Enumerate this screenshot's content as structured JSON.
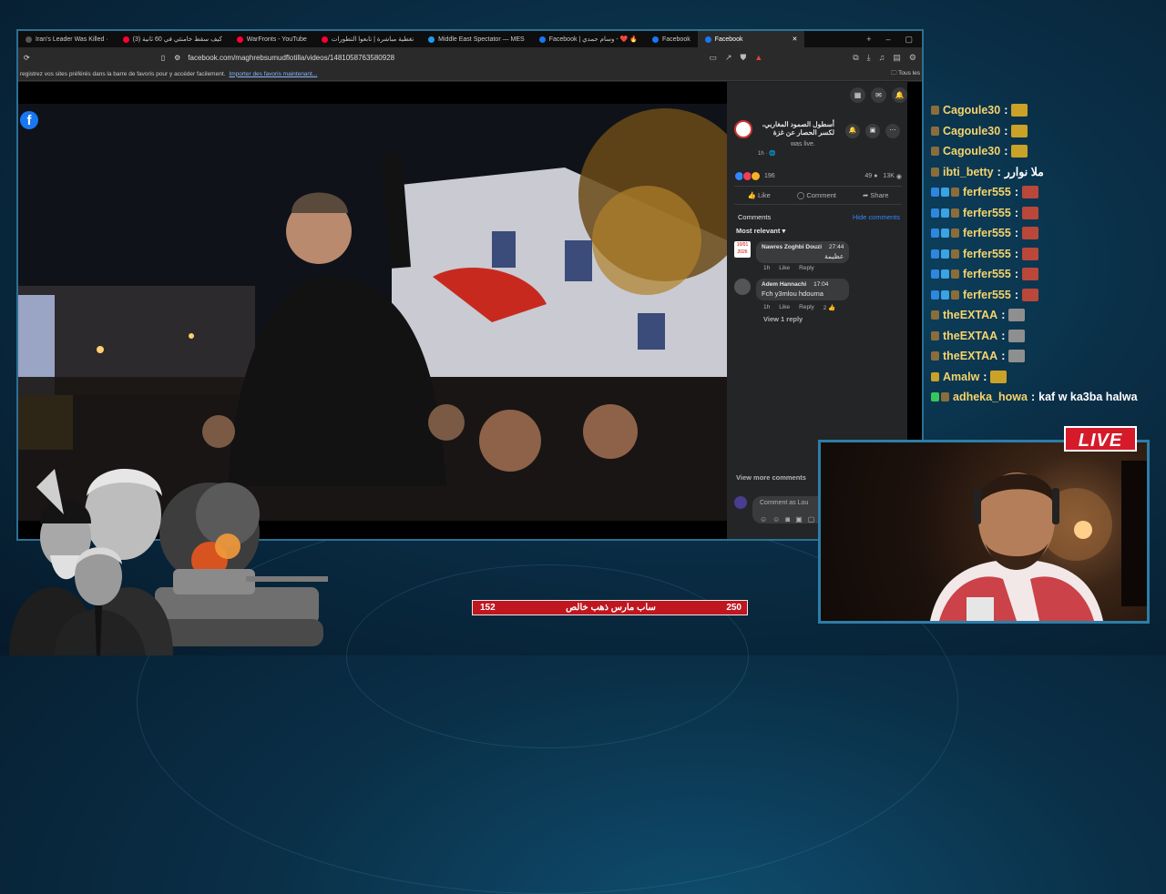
{
  "browser": {
    "tabs": [
      {
        "label": "Iran's Leader Was Killed ·",
        "color": "#555555"
      },
      {
        "label": "(3) كيف سقط خامنئي في 60 ثانية",
        "color": "#ff0033"
      },
      {
        "label": "WarFronts - YouTube",
        "color": "#ff0033"
      },
      {
        "label": "تغطية مباشرة | تابعوا التطورات",
        "color": "#ff0033"
      },
      {
        "label": "Middle East Spectator — MES",
        "color": "#1d9bf0"
      },
      {
        "label": "Facebook | وسام حمدي - ❤️ 🔥",
        "color": "#1877f2"
      },
      {
        "label": "Facebook",
        "color": "#1877f2"
      },
      {
        "label": "Facebook",
        "color": "#1877f2",
        "active": true
      }
    ],
    "url": "facebook.com/maghrebsumudflotilla/videos/1481058763580928",
    "bookmarks_text": "registrez vos sites préférés dans la barre de favoris pour y accéder facilement.",
    "bookmarks_link": "Importer des favoris maintenant...",
    "all_bookmarks": "Tous les"
  },
  "facebook": {
    "page_name": "أسطول الصمود المغاربي، لكسر الحصار عن غزة",
    "was_live": "was live.",
    "post_time": "1h · 🌐",
    "reactions_count": "196",
    "comments_count": "49",
    "views_count": "13K",
    "actions": {
      "like": "Like",
      "comment": "Comment",
      "share": "Share"
    },
    "comments_label": "Comments",
    "hide_comments": "Hide comments",
    "sort": "Most relevant",
    "comments": [
      {
        "author": "Nawres Zoghbi Douzi",
        "time": "27:44",
        "text": "عظيمة",
        "age": "1h",
        "like": "Like",
        "reply": "Reply",
        "badge": "10/01 2026"
      },
      {
        "author": "Adem Hannachi",
        "time": "17:04",
        "text": "Fch y3mlou hdouma",
        "age": "1h",
        "like": "Like",
        "reply": "Reply",
        "likes": "2"
      }
    ],
    "view_replies": "View 1 reply",
    "view_more": "View more comments",
    "composer_placeholder": "Comment as Lou"
  },
  "chat": [
    {
      "user": "Cagoule30",
      "text": "",
      "badges": [
        "#8a6d3b"
      ],
      "emote": "#c9a227"
    },
    {
      "user": "Cagoule30",
      "text": "",
      "badges": [
        "#8a6d3b"
      ],
      "emote": "#c9a227"
    },
    {
      "user": "Cagoule30",
      "text": "",
      "badges": [
        "#8a6d3b"
      ],
      "emote": "#c9a227"
    },
    {
      "user": "ibti_betty",
      "text": "ملا نوارر",
      "badges": [
        "#8a6d3b"
      ],
      "emote": ""
    },
    {
      "user": "ferfer555",
      "text": "",
      "badges": [
        "#2e86de",
        "#3aa3e3",
        "#8a6d3b"
      ],
      "emote": "#b9473a"
    },
    {
      "user": "ferfer555",
      "text": "",
      "badges": [
        "#2e86de",
        "#3aa3e3",
        "#8a6d3b"
      ],
      "emote": "#b9473a"
    },
    {
      "user": "ferfer555",
      "text": "",
      "badges": [
        "#2e86de",
        "#3aa3e3",
        "#8a6d3b"
      ],
      "emote": "#b9473a"
    },
    {
      "user": "ferfer555",
      "text": "",
      "badges": [
        "#2e86de",
        "#3aa3e3",
        "#8a6d3b"
      ],
      "emote": "#b9473a"
    },
    {
      "user": "ferfer555",
      "text": "",
      "badges": [
        "#2e86de",
        "#3aa3e3",
        "#8a6d3b"
      ],
      "emote": "#b9473a"
    },
    {
      "user": "ferfer555",
      "text": "",
      "badges": [
        "#2e86de",
        "#3aa3e3",
        "#8a6d3b"
      ],
      "emote": "#b9473a"
    },
    {
      "user": "theEXTAA",
      "text": "",
      "badges": [
        "#8a6d3b"
      ],
      "emote": "#8f8f8f"
    },
    {
      "user": "theEXTAA",
      "text": "",
      "badges": [
        "#8a6d3b"
      ],
      "emote": "#8f8f8f"
    },
    {
      "user": "theEXTAA",
      "text": "",
      "badges": [
        "#8a6d3b"
      ],
      "emote": "#8f8f8f"
    },
    {
      "user": "Amalw",
      "text": "",
      "badges": [
        "#c9a227"
      ],
      "emote": "#c9a227"
    },
    {
      "user": "adheka_howa",
      "text": "kaf w ka3ba halwa",
      "badges": [
        "#35c759",
        "#8a6d3b"
      ],
      "emote": ""
    }
  ],
  "overlay": {
    "live": "LIVE",
    "goal_current": "152",
    "goal_label": "ساب مارس ذهب خالص",
    "goal_target": "250",
    "goal_progress": 0.608
  }
}
